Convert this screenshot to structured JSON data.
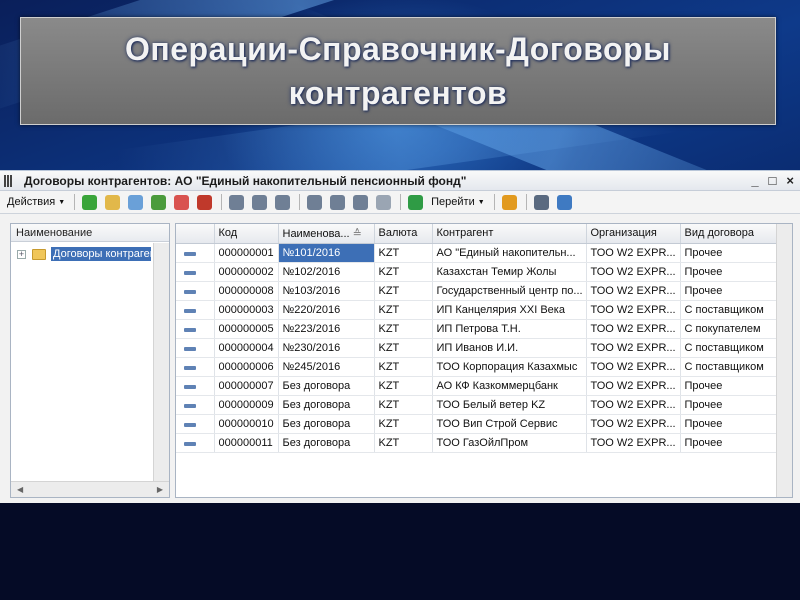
{
  "slide": {
    "title": "Операции-Справочник-Договоры контрагентов"
  },
  "window": {
    "title": "Договоры контрагентов: АО \"Единый накопительный пенсионный фонд\"",
    "controls": [
      "_",
      "□",
      "×"
    ]
  },
  "toolbar": {
    "actions_label": "Действия",
    "goto_label": "Перейти",
    "icons": [
      {
        "name": "add-icon",
        "color": "#3aa53a"
      },
      {
        "name": "add-folder-icon",
        "color": "#e2b84a"
      },
      {
        "name": "copy-icon",
        "color": "#6aa0d8"
      },
      {
        "name": "edit-icon",
        "color": "#4b9b3c"
      },
      {
        "name": "delete-icon",
        "color": "#d9534f"
      },
      {
        "name": "mark-delete-icon",
        "color": "#c0392b"
      },
      {
        "name": "hierarchy-icon",
        "color": "#6f7f95"
      },
      {
        "name": "list-icon",
        "color": "#6f7f95"
      },
      {
        "name": "move-icon",
        "color": "#6f7f95"
      },
      {
        "name": "filter-settings-icon",
        "color": "#6f7f95"
      },
      {
        "name": "filter-icon",
        "color": "#6f7f95"
      },
      {
        "name": "filter-dropdown-icon",
        "color": "#6f7f95"
      },
      {
        "name": "clear-filter-icon",
        "color": "#9aa5b3"
      },
      {
        "name": "refresh-icon",
        "color": "#2f9b45"
      },
      {
        "name": "help-icon",
        "color": "#e29a1f"
      },
      {
        "name": "columns-icon",
        "color": "#5a6a80"
      },
      {
        "name": "layout-icon",
        "color": "#3f7ac2"
      }
    ]
  },
  "tree": {
    "header": "Наименование",
    "items": [
      {
        "label": "Договоры контрагентов",
        "expand": "+"
      }
    ]
  },
  "table": {
    "columns": [
      "",
      "Код",
      "Наименова...",
      "Валюта",
      "Контрагент",
      "Организация",
      "Вид договора"
    ],
    "selected_row": 0,
    "rows": [
      {
        "code": "000000001",
        "name": "№101/2016",
        "currency": "KZT",
        "counterparty": "АО \"Единый накопительн...",
        "org": "ТОО W2 EXPR...",
        "type": "Прочее"
      },
      {
        "code": "000000002",
        "name": "№102/2016",
        "currency": "KZT",
        "counterparty": "Казахстан Темир Жолы",
        "org": "ТОО W2 EXPR...",
        "type": "Прочее"
      },
      {
        "code": "000000008",
        "name": "№103/2016",
        "currency": "KZT",
        "counterparty": "Государственный центр по...",
        "org": "ТОО W2 EXPR...",
        "type": "Прочее"
      },
      {
        "code": "000000003",
        "name": "№220/2016",
        "currency": "KZT",
        "counterparty": "ИП Канцелярия XXI Века",
        "org": "ТОО W2 EXPR...",
        "type": "С поставщиком"
      },
      {
        "code": "000000005",
        "name": "№223/2016",
        "currency": "KZT",
        "counterparty": "ИП Петрова Т.Н.",
        "org": "ТОО W2 EXPR...",
        "type": "С покупателем"
      },
      {
        "code": "000000004",
        "name": "№230/2016",
        "currency": "KZT",
        "counterparty": "ИП Иванов И.И.",
        "org": "ТОО W2 EXPR...",
        "type": "С поставщиком"
      },
      {
        "code": "000000006",
        "name": "№245/2016",
        "currency": "KZT",
        "counterparty": "ТОО Корпорация Казахмыс",
        "org": "ТОО W2 EXPR...",
        "type": "С поставщиком"
      },
      {
        "code": "000000007",
        "name": "Без договора",
        "currency": "KZT",
        "counterparty": "АО КФ Казкоммерцбанк",
        "org": "ТОО W2 EXPR...",
        "type": "Прочее"
      },
      {
        "code": "000000009",
        "name": "Без договора",
        "currency": "KZT",
        "counterparty": "ТОО Белый ветер KZ",
        "org": "ТОО W2 EXPR...",
        "type": "Прочее"
      },
      {
        "code": "000000010",
        "name": "Без договора",
        "currency": "KZT",
        "counterparty": "ТОО Вип Строй Сервис",
        "org": "ТОО W2 EXPR...",
        "type": "Прочее"
      },
      {
        "code": "000000011",
        "name": "Без договора",
        "currency": "KZT",
        "counterparty": "ТОО ГазОйлПром",
        "org": "ТОО W2 EXPR...",
        "type": "Прочее"
      }
    ]
  }
}
